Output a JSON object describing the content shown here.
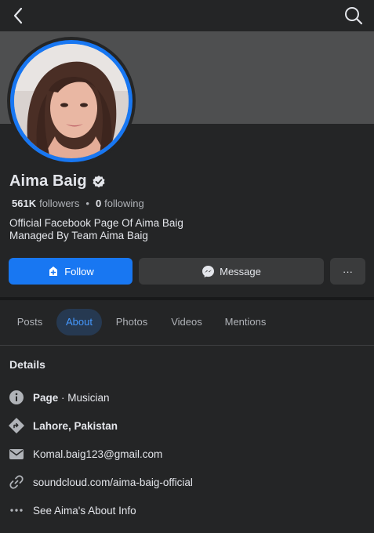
{
  "profile": {
    "name": "Aima Baig",
    "followers_count": "561K",
    "followers_label": "followers",
    "following_count": "0",
    "following_label": "following",
    "bio_line1": "Official Facebook Page Of Aima Baig",
    "bio_line2": "Managed By Team Aima Baig"
  },
  "actions": {
    "follow_label": "Follow",
    "message_label": "Message",
    "more_label": "···"
  },
  "tabs": [
    {
      "label": "Posts",
      "active": false
    },
    {
      "label": "About",
      "active": true
    },
    {
      "label": "Photos",
      "active": false
    },
    {
      "label": "Videos",
      "active": false
    },
    {
      "label": "Mentions",
      "active": false
    }
  ],
  "details": {
    "title": "Details",
    "page_type_label": "Page",
    "page_type_value": " · Musician",
    "location": "Lahore, Pakistan",
    "email": "Komal.baig123@gmail.com",
    "website": "soundcloud.com/aima-baig-official",
    "see_more": "See Aima's About Info"
  },
  "icons": {
    "back": "chevron-left-icon",
    "search": "search-icon",
    "verified": "verified-badge-icon",
    "follow": "follow-page-icon",
    "message": "messenger-icon",
    "info": "info-icon",
    "location": "directions-icon",
    "email": "envelope-icon",
    "link": "link-icon",
    "more": "more-dots-icon"
  },
  "colors": {
    "background": "#242526",
    "cover": "#4e4f50",
    "accent": "#1877f2",
    "active_tab_text": "#4599ff",
    "active_tab_bg": "#263951",
    "secondary_button": "#3a3b3c"
  }
}
